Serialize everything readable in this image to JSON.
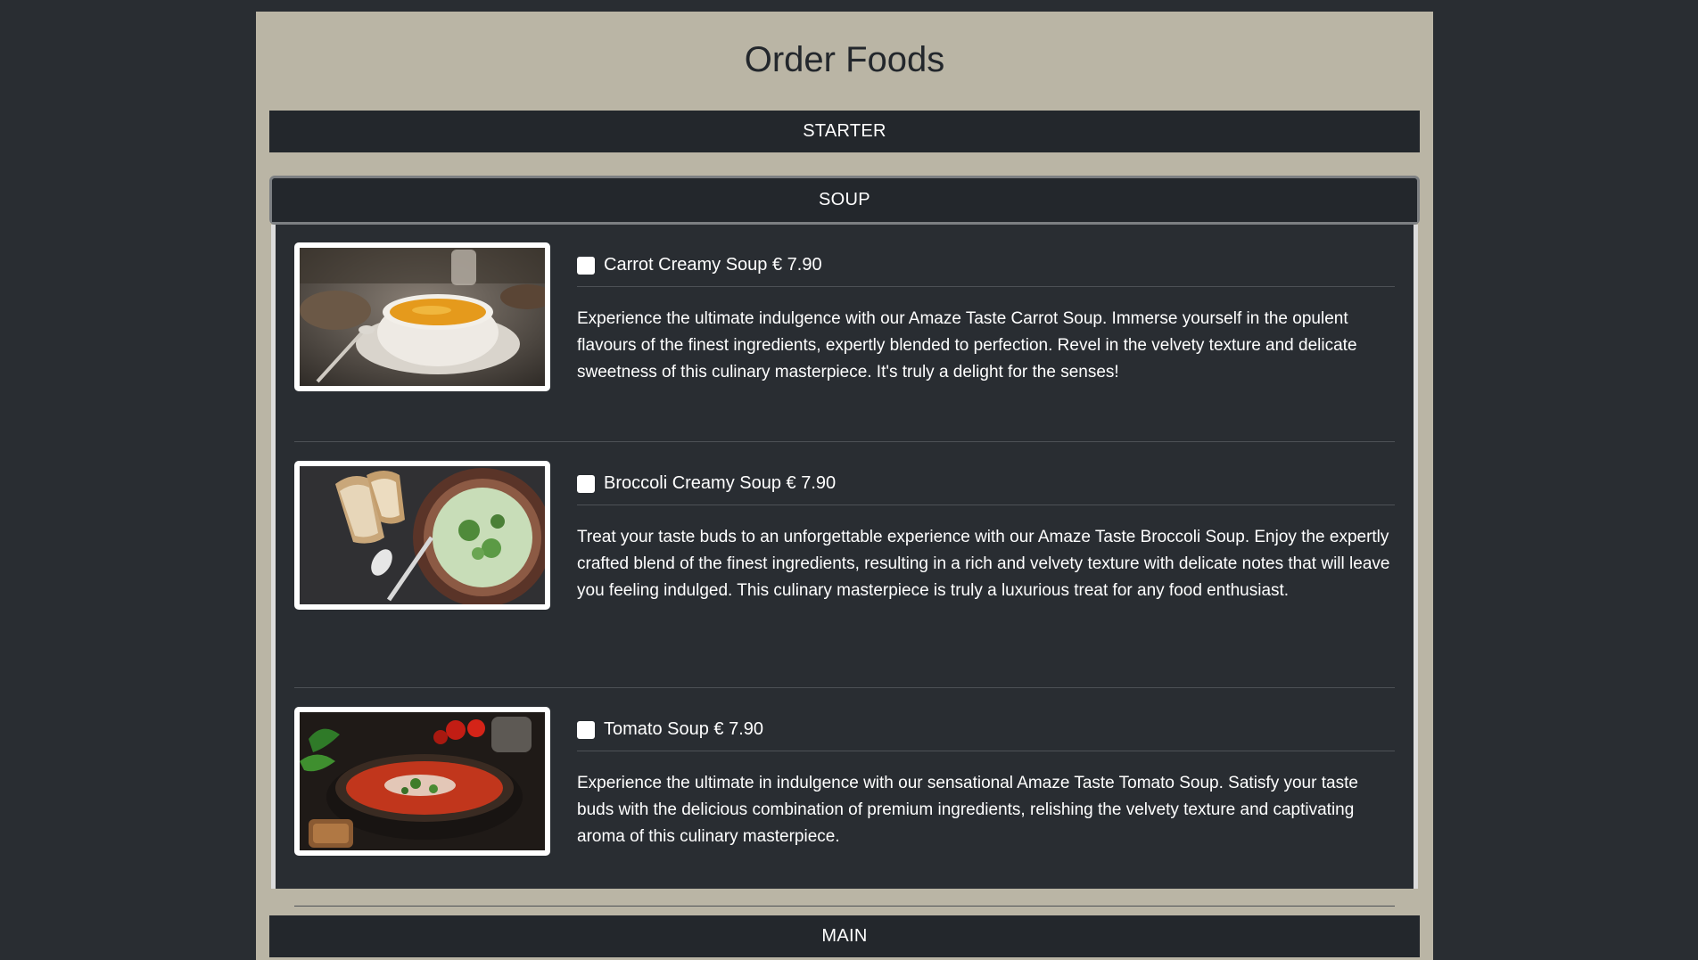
{
  "title": "Order Foods",
  "sections": {
    "starter": "STARTER",
    "soup": "SOUP",
    "main": "MAIN"
  },
  "soups": [
    {
      "name": "Carrot Creamy Soup € 7.90",
      "description": "Experience the ultimate indulgence with our Amaze Taste Carrot Soup. Immerse yourself in the opulent flavours of the finest ingredients, expertly blended to perfection. Revel in the velvety texture and delicate sweetness of this culinary masterpiece. It's truly a delight for the senses!",
      "checked": false
    },
    {
      "name": "Broccoli Creamy Soup € 7.90",
      "description": "Treat your taste buds to an unforgettable experience with our Amaze Taste Broccoli Soup. Enjoy the expertly crafted blend of the finest ingredients, resulting in a rich and velvety texture with delicate notes that will leave you feeling indulged. This culinary masterpiece is truly a luxurious treat for any food enthusiast.",
      "checked": false
    },
    {
      "name": "Tomato Soup € 7.90",
      "description": "Experience the ultimate in indulgence with our sensational Amaze Taste Tomato Soup. Satisfy your taste buds with the delicious combination of premium ingredients, relishing the velvety texture and captivating aroma of this culinary masterpiece.",
      "checked": false
    }
  ]
}
